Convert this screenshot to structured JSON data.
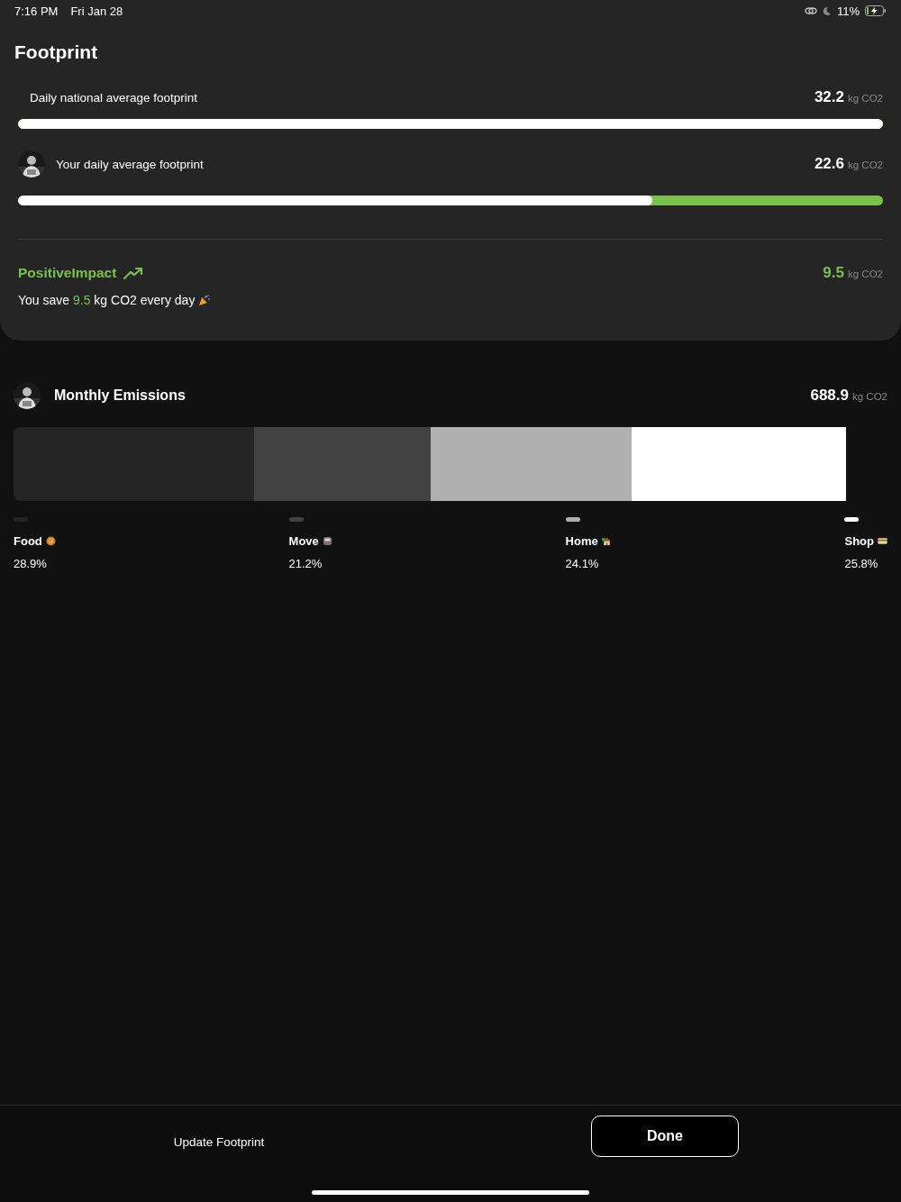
{
  "status_bar": {
    "time": "7:16 PM",
    "date": "Fri Jan 28",
    "battery": "11%"
  },
  "footprint": {
    "title": "Footprint",
    "national": {
      "label": "Daily national average footprint",
      "value": "32.2",
      "unit": "kg CO2",
      "level": 1
    },
    "yours": {
      "label": "Your daily average footprint",
      "value": "22.6",
      "unit": "kg CO2",
      "level": 0.733
    },
    "impact": {
      "title": "PositiveImpact",
      "value": "9.5",
      "unit": "kg CO2",
      "sentence": "You save **9.5** kg CO2 every day"
    }
  },
  "monthly": {
    "title": "Monthly Emissions",
    "value": "688.9",
    "unit": "kg CO2",
    "categories": [
      {
        "kind": "food",
        "name": "Food",
        "percent": "28.9%",
        "color": "#252525"
      },
      {
        "kind": "move",
        "name": "Move",
        "percent": "21.2%",
        "color": "#424242"
      },
      {
        "kind": "home",
        "name": "Home",
        "percent": "24.1%",
        "color": "#b0b0b0"
      },
      {
        "kind": "shop",
        "name": "Shop",
        "percent": "25.8%",
        "color": "#ffffff"
      }
    ]
  },
  "footer": {
    "link": "Update Footprint",
    "button": "Done"
  }
}
